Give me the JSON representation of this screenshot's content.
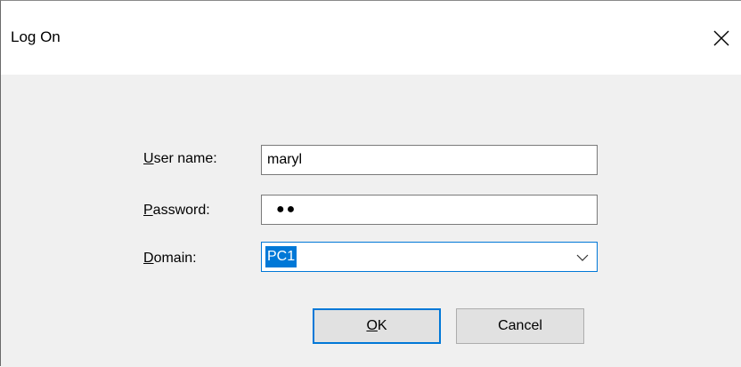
{
  "dialog": {
    "title": "Log On",
    "close_icon": "close-icon"
  },
  "form": {
    "username": {
      "label_accel": "U",
      "label_rest": "ser name:",
      "value": "maryl"
    },
    "password": {
      "label_accel": "P",
      "label_rest": "assword:",
      "masked_value": "●●"
    },
    "domain": {
      "label_accel": "D",
      "label_rest": "omain:",
      "selected_value": "PC1",
      "dropdown_icon": "chevron-down-icon"
    }
  },
  "buttons": {
    "ok_accel": "O",
    "ok_rest": "K",
    "cancel_label": "Cancel"
  },
  "colors": {
    "accent": "#0078d7",
    "dialog_bg": "#f0f0f0",
    "button_bg": "#e1e1e1"
  }
}
